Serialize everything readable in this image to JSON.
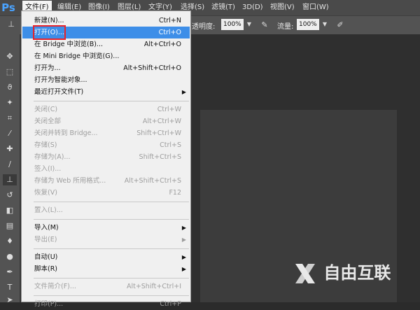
{
  "app": {
    "logo": "Ps"
  },
  "menubar": [
    {
      "label": "文件(F)",
      "active": true
    },
    {
      "label": "编辑(E)"
    },
    {
      "label": "图像(I)"
    },
    {
      "label": "图层(L)"
    },
    {
      "label": "文字(Y)"
    },
    {
      "label": "选择(S)"
    },
    {
      "label": "滤镜(T)"
    },
    {
      "label": "3D(D)"
    },
    {
      "label": "视图(V)"
    },
    {
      "label": "窗口(W)"
    }
  ],
  "options": {
    "opacity_label": "透明度:",
    "opacity_value": "100%",
    "flow_label": "流量:",
    "flow_value": "100%"
  },
  "file_menu": [
    {
      "label": "新建(N)...",
      "shortcut": "Ctrl+N"
    },
    {
      "label": "打开(O)...",
      "shortcut": "Ctrl+O",
      "highlighted": true
    },
    {
      "label": "在 Bridge 中浏览(B)...",
      "shortcut": "Alt+Ctrl+O"
    },
    {
      "label": "在 Mini Bridge 中浏览(G)...",
      "shortcut": ""
    },
    {
      "label": "打开为...",
      "shortcut": "Alt+Shift+Ctrl+O"
    },
    {
      "label": "打开为智能对象...",
      "shortcut": ""
    },
    {
      "label": "最近打开文件(T)",
      "shortcut": "",
      "submenu": true
    },
    {
      "label": "关闭(C)",
      "shortcut": "Ctrl+W",
      "disabled": true
    },
    {
      "label": "关闭全部",
      "shortcut": "Alt+Ctrl+W",
      "disabled": true
    },
    {
      "label": "关闭并转到 Bridge...",
      "shortcut": "Shift+Ctrl+W",
      "disabled": true
    },
    {
      "label": "存储(S)",
      "shortcut": "Ctrl+S",
      "disabled": true
    },
    {
      "label": "存储为(A)...",
      "shortcut": "Shift+Ctrl+S",
      "disabled": true
    },
    {
      "label": "签入(I)...",
      "shortcut": "",
      "disabled": true
    },
    {
      "label": "存储为 Web 所用格式...",
      "shortcut": "Alt+Shift+Ctrl+S",
      "disabled": true
    },
    {
      "label": "恢复(V)",
      "shortcut": "F12",
      "disabled": true
    },
    {
      "label": "置入(L)...",
      "shortcut": "",
      "disabled": true
    },
    {
      "label": "导入(M)",
      "shortcut": "",
      "submenu": true
    },
    {
      "label": "导出(E)",
      "shortcut": "",
      "submenu": true,
      "disabled": true
    },
    {
      "label": "自动(U)",
      "shortcut": "",
      "submenu": true
    },
    {
      "label": "脚本(R)",
      "shortcut": "",
      "submenu": true
    },
    {
      "label": "文件简介(F)...",
      "shortcut": "Alt+Shift+Ctrl+I",
      "disabled": true
    },
    {
      "label": "打印(P)...",
      "shortcut": "Ctrl+P",
      "disabled": true
    }
  ],
  "tools": [
    "move-tool",
    "marquee-tool",
    "lasso-tool",
    "quick-select-tool",
    "crop-tool",
    "eyedropper-tool",
    "healing-brush-tool",
    "brush-tool",
    "clone-stamp-tool",
    "history-brush-tool",
    "eraser-tool",
    "gradient-tool",
    "blur-tool",
    "dodge-tool",
    "pen-tool",
    "type-tool",
    "path-select-tool"
  ],
  "watermark": {
    "text": "自由互联"
  }
}
